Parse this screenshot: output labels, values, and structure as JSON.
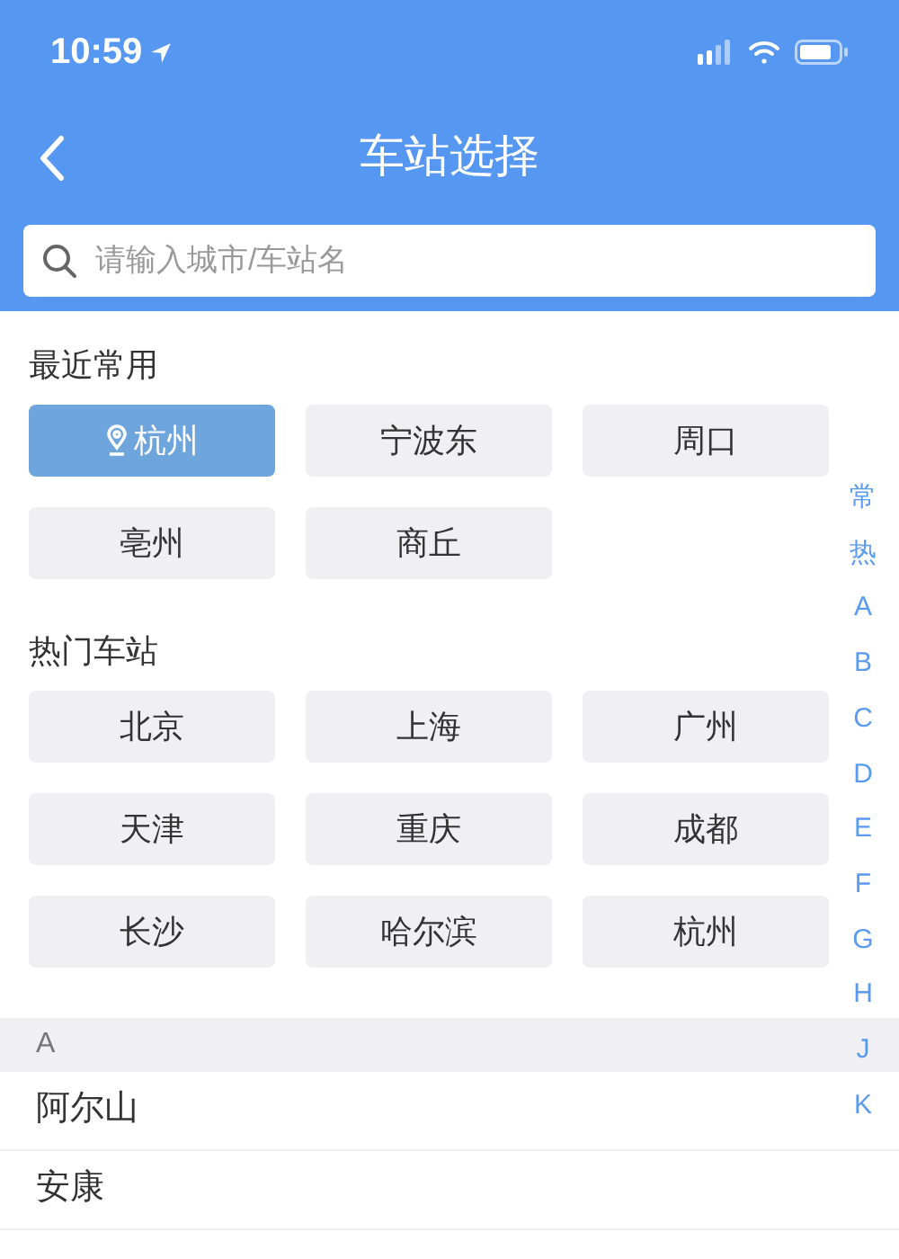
{
  "status_bar": {
    "time": "10:59"
  },
  "nav": {
    "title": "车站选择"
  },
  "search": {
    "placeholder": "请输入城市/车站名"
  },
  "sections": [
    {
      "title": "最近常用",
      "stations": [
        {
          "name": "杭州",
          "selected": true
        },
        {
          "name": "宁波东",
          "selected": false
        },
        {
          "name": "周口",
          "selected": false
        },
        {
          "name": "亳州",
          "selected": false
        },
        {
          "name": "商丘",
          "selected": false
        }
      ]
    },
    {
      "title": "热门车站",
      "stations": [
        {
          "name": "北京",
          "selected": false
        },
        {
          "name": "上海",
          "selected": false
        },
        {
          "name": "广州",
          "selected": false
        },
        {
          "name": "天津",
          "selected": false
        },
        {
          "name": "重庆",
          "selected": false
        },
        {
          "name": "成都",
          "selected": false
        },
        {
          "name": "长沙",
          "selected": false
        },
        {
          "name": "哈尔滨",
          "selected": false
        },
        {
          "name": "杭州",
          "selected": false
        }
      ]
    }
  ],
  "list": {
    "header": "A",
    "items": [
      "阿尔山",
      "安康"
    ]
  },
  "index_bar": [
    "常",
    "热",
    "A",
    "B",
    "C",
    "D",
    "E",
    "F",
    "G",
    "H",
    "J",
    "K"
  ]
}
